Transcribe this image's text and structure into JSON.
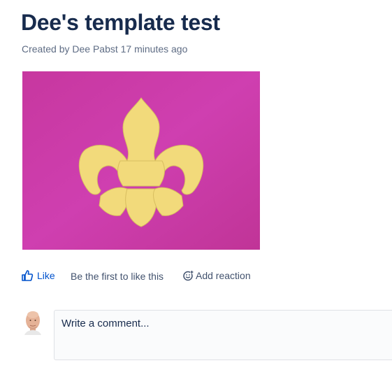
{
  "page": {
    "title": "Dee's template test",
    "byline": "Created by Dee Pabst 17 minutes ago"
  },
  "image": {
    "background_color": "#cc3aa8",
    "shape_color": "#f1d97a",
    "icon": "fleur-de-lis-image"
  },
  "actions": {
    "like_label": "Like",
    "like_status": "Be the first to like this",
    "reaction_label": "Add reaction",
    "accent_color": "#0052cc"
  },
  "comment": {
    "placeholder": "Write a comment..."
  }
}
